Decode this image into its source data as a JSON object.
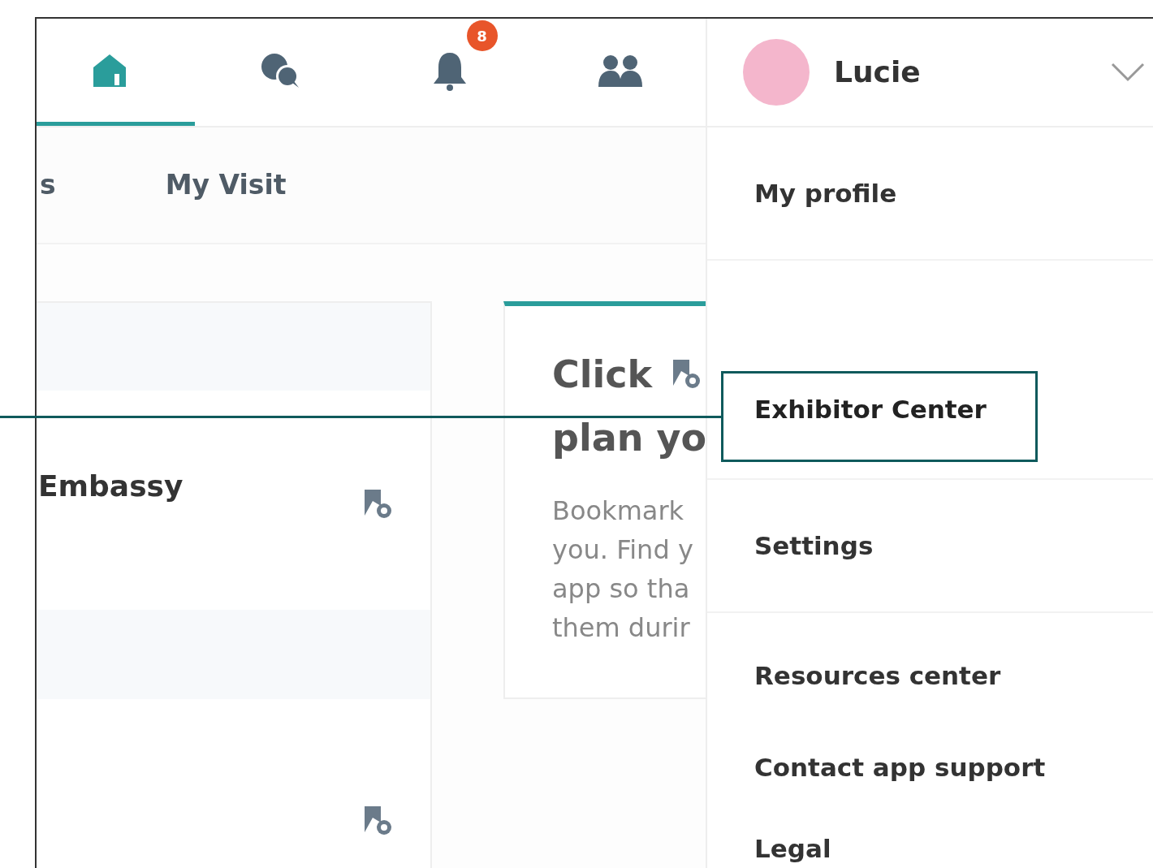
{
  "nav": [
    {
      "kind": "home",
      "selected": true
    },
    {
      "kind": "chat",
      "selected": false
    },
    {
      "kind": "bell",
      "selected": false,
      "badge": "8"
    },
    {
      "kind": "people",
      "selected": false
    }
  ],
  "tabs": [
    "s",
    "My Visit"
  ],
  "list_card": {
    "rows": [
      {
        "title": "Embassy"
      },
      {}
    ]
  },
  "promo_card": {
    "heading_lines": [
      "Click",
      "plan yo"
    ],
    "body_lines": [
      "Bookmark",
      "you. Find y",
      "app so tha",
      "them durir"
    ]
  },
  "user_menu": {
    "name": "Lucie",
    "items": [
      {
        "label": "My profile",
        "highlighted": false
      },
      {
        "label": "Exhibitor Center",
        "highlighted": true
      },
      {
        "label": "Settings",
        "highlighted": false
      },
      {
        "label": "Resources center",
        "highlighted": false
      },
      {
        "label": "Contact app support",
        "highlighted": false
      },
      {
        "label": "Legal",
        "highlighted": false
      }
    ]
  }
}
